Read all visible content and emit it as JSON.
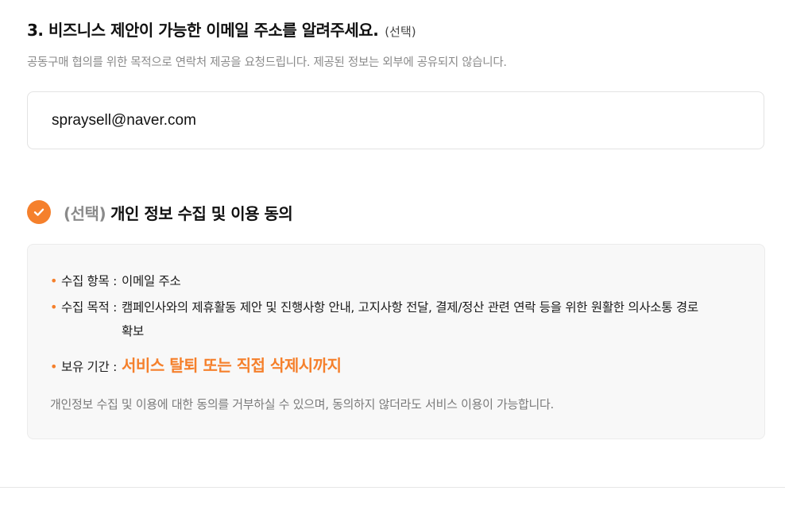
{
  "question": {
    "title": "3. 비즈니스 제안이 가능한 이메일 주소를 알려주세요.",
    "optional_tag": "(선택)",
    "helper_text": "공동구매 협의를 위한 목적으로 연락처 제공을 요청드립니다. 제공된 정보는 외부에 공유되지 않습니다."
  },
  "email_field": {
    "value": "spraysell@naver.com"
  },
  "consent": {
    "checked": true,
    "optional_tag": "(선택)",
    "label": "개인 정보 수집 및 이용 동의",
    "accent_color": "#f5802c"
  },
  "privacy_info": {
    "items": [
      {
        "bullet": "•",
        "label": "수집 항목 :",
        "value": "이메일 주소"
      },
      {
        "bullet": "•",
        "label": "수집 목적 :",
        "value": "캠페인사와의 제휴활동 제안 및 진행사항 안내, 고지사항 전달, 결제/정산 관련 연락 등을 위한 원활한 의사소통 경로 확보"
      },
      {
        "bullet": "•",
        "label": "보유 기간 :",
        "value": "서비스 탈퇴 또는 직접 삭제시까지"
      }
    ],
    "footnote": "개인정보 수집 및 이용에 대한 동의를 거부하실 수 있으며, 동의하지 않더라도 서비스 이용이 가능합니다."
  }
}
